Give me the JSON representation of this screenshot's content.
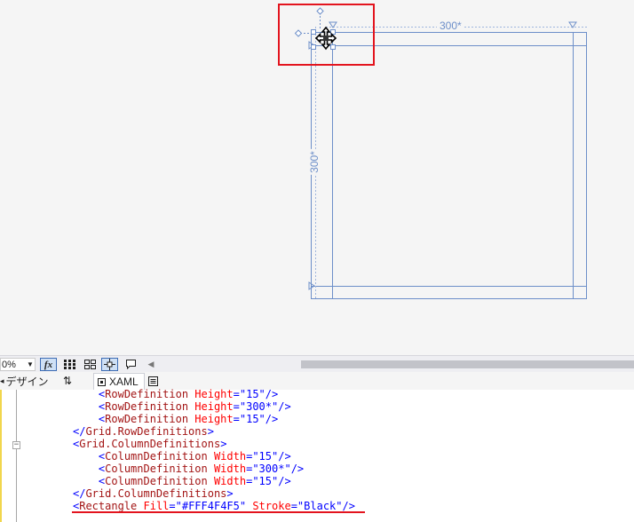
{
  "designer": {
    "column_size_label": "300*",
    "row_size_label": "300*",
    "colors": {
      "grid_line": "#6d8fc9",
      "selection": "#e3141e",
      "canvas": "#f5f5f5"
    }
  },
  "toolbar": {
    "zoom_value": "0%",
    "fx_label": "fx"
  },
  "tabs": {
    "design_label": "デザイン",
    "swap_label": "⇅",
    "xaml_label": "XAML"
  },
  "code_lines": [
    {
      "indent": "    ",
      "tag": "RowDefinition",
      "attr": "Height",
      "value": "15"
    },
    {
      "indent": "    ",
      "tag": "RowDefinition",
      "attr": "Height",
      "value": "300*"
    },
    {
      "indent": "    ",
      "tag": "RowDefinition",
      "attr": "Height",
      "value": "15"
    },
    {
      "close": "Grid.RowDefinitions"
    },
    {
      "open": "Grid.ColumnDefinitions"
    },
    {
      "indent": "    ",
      "tag": "ColumnDefinition",
      "attr": "Width",
      "value": "15"
    },
    {
      "indent": "    ",
      "tag": "ColumnDefinition",
      "attr": "Width",
      "value": "300*"
    },
    {
      "indent": "    ",
      "tag": "ColumnDefinition",
      "attr": "Width",
      "value": "15"
    },
    {
      "close": "Grid.ColumnDefinitions"
    },
    {
      "tag": "Rectangle",
      "attr": "Fill",
      "value": "#FFF4F4F5",
      "attr2": "Stroke",
      "value2": "Black"
    }
  ]
}
